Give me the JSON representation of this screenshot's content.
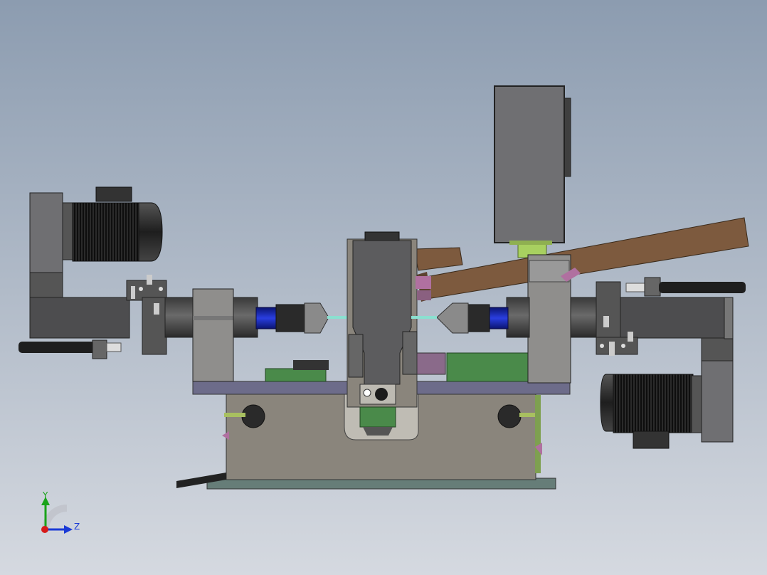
{
  "viewport": {
    "background_top": "#8c9cb0",
    "background_bottom": "#d5d9e0"
  },
  "colors": {
    "steel_dark": "#4d4d4f",
    "steel_mid": "#6f6f72",
    "steel_light": "#8f8e8c",
    "frame_gray": "#8a857c",
    "plate_purple": "#6d6c8a",
    "base_teal": "#667d78",
    "motor_black": "#2c2c2e",
    "spindle_blue": "#1a2bb8",
    "bar_brown": "#7d5a3e",
    "pcb_green": "#4a8a4a",
    "accent_magenta": "#b070a0",
    "lime": "#a8d060",
    "rail_black": "#222222"
  },
  "triad": {
    "y_label": "Y",
    "z_label": "Z",
    "y_color": "#1aa31a",
    "z_color": "#1a3ad6",
    "x_color": "#d61a1a"
  }
}
